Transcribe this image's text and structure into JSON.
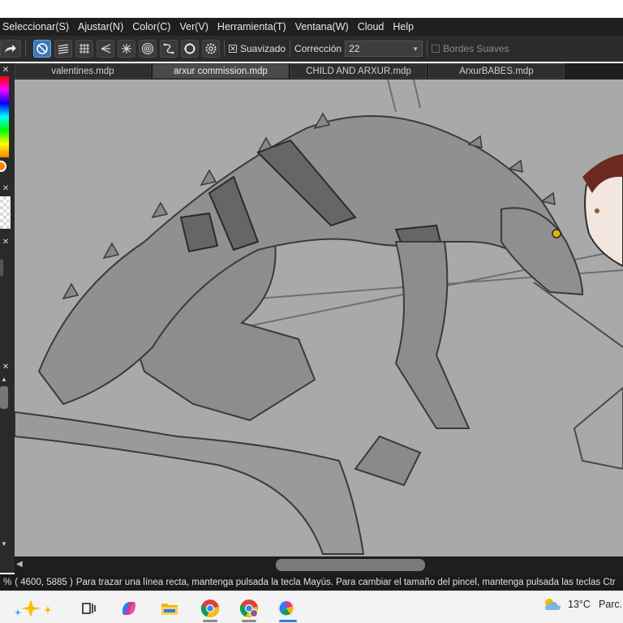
{
  "menu": [
    "Seleccionar(S)",
    "Ajustar(N)",
    "Color(C)",
    "Ver(V)",
    "Herramienta(T)",
    "Ventana(W)",
    "Cloud",
    "Help"
  ],
  "toolbar": {
    "smoothing_label": "Suavizado",
    "smoothing_checked": "✕",
    "correction_label": "Corrección",
    "correction_value": "22",
    "soft_edges_label": "Bordes Suaves",
    "tool_icons": [
      "redo-arrow-icon",
      "forbidden-snap-icon",
      "parallel-lines-icon",
      "grid-icon",
      "perspective-lines-icon",
      "radial-lines-icon",
      "concentric-circles-icon",
      "curve-icon",
      "ellipse-icon",
      "settings-gear-icon"
    ]
  },
  "tabs": [
    {
      "label": "valentines.mdp",
      "active": false
    },
    {
      "label": "arxur commission.mdp",
      "active": true
    },
    {
      "label": "CHILD AND ARXUR.mdp",
      "active": false
    },
    {
      "label": "ArxurBABES.mdp",
      "active": false
    }
  ],
  "statusbar": {
    "zoom_suffix": "%",
    "coords": "( 4600, 5885 )",
    "hint": "Para trazar una línea recta, mantenga pulsada la tecla Mayús. Para cambiar el tamaño del pincel, mantenga pulsada las teclas Ctr"
  },
  "taskbar": {
    "icons": [
      "copilot-sparkle-icon",
      "task-view-icon",
      "copilot-app-icon",
      "file-explorer-icon",
      "chrome-icon",
      "chrome-profile-icon",
      "medibang-paint-icon"
    ],
    "temperature": "13°C",
    "weather_text": "Parc."
  },
  "colors": {
    "canvas_bg": "#a9a9a9",
    "accent": "#3b78b8",
    "eye_yellow": "#e8b400"
  }
}
